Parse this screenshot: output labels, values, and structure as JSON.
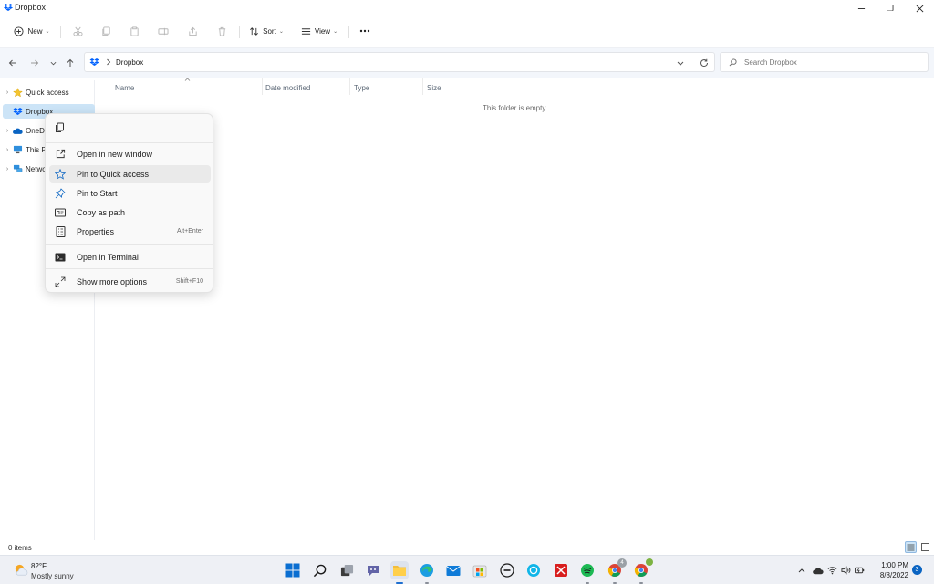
{
  "window": {
    "title": "Dropbox",
    "restore_glyph": "❐"
  },
  "toolbar": {
    "new_label": "New",
    "sort_label": "Sort",
    "view_label": "View"
  },
  "address": {
    "path": "Dropbox"
  },
  "search": {
    "placeholder": "Search Dropbox"
  },
  "navpane": {
    "items": [
      {
        "label": "Quick access"
      },
      {
        "label": "Dropbox"
      },
      {
        "label": "OneDrive"
      },
      {
        "label": "This PC"
      },
      {
        "label": "Network"
      }
    ]
  },
  "columns": {
    "name": "Name",
    "date_modified": "Date modified",
    "type": "Type",
    "size": "Size"
  },
  "content": {
    "empty_message": "This folder is empty."
  },
  "context_menu": {
    "items": [
      {
        "label": "Open in new window",
        "shortcut": ""
      },
      {
        "label": "Pin to Quick access",
        "shortcut": ""
      },
      {
        "label": "Pin to Start",
        "shortcut": ""
      },
      {
        "label": "Copy as path",
        "shortcut": ""
      },
      {
        "label": "Properties",
        "shortcut": "Alt+Enter"
      },
      {
        "label": "Open in Terminal",
        "shortcut": ""
      },
      {
        "label": "Show more options",
        "shortcut": "Shift+F10"
      }
    ]
  },
  "status": {
    "items_count": "0 items"
  },
  "taskbar": {
    "weather_temp": "82°F",
    "weather_desc": "Mostly sunny",
    "time": "1:00 PM",
    "date": "8/8/2022",
    "notification_count": "3",
    "chrome_badge_count": "4"
  },
  "colors": {
    "accent": "#0a64c2",
    "selected_nav": "#cce4f7",
    "dropbox_blue": "#0061fe"
  }
}
